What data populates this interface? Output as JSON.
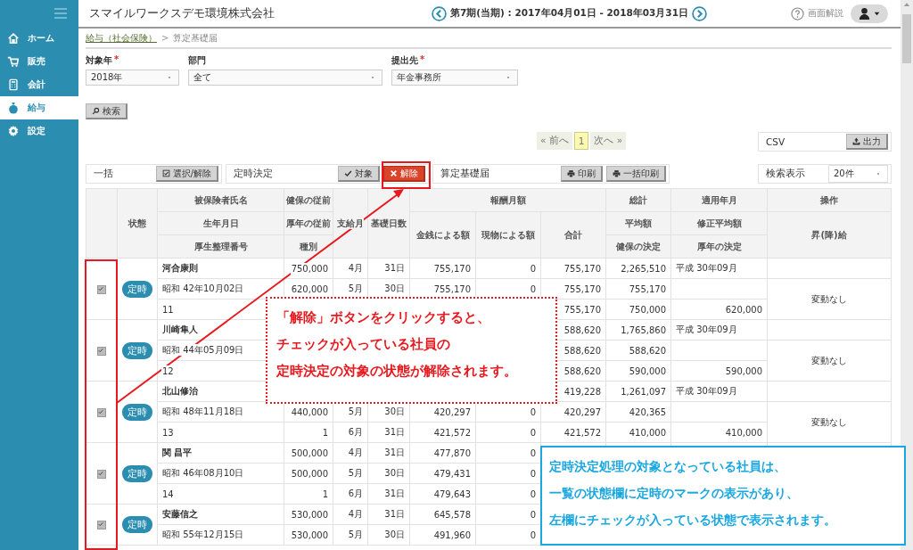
{
  "sidebar": {
    "items": [
      {
        "label": "ホーム",
        "selected": false
      },
      {
        "label": "販売",
        "selected": false
      },
      {
        "label": "会計",
        "selected": false
      },
      {
        "label": "給与",
        "selected": true
      },
      {
        "label": "設定",
        "selected": false
      }
    ]
  },
  "header": {
    "company": "スマイルワークスデモ環境株式会社",
    "period": "第7期(当期) : 2017年04月01日 - 2018年03月31日",
    "help": "画面解説"
  },
  "breadcrumb": {
    "items": [
      {
        "label": "給与（社会保険）",
        "link": true
      },
      {
        "label": "算定基礎届",
        "link": false
      }
    ],
    "separator": ">"
  },
  "filters": [
    {
      "label": "対象年",
      "required_mark": "*",
      "value": "2018年"
    },
    {
      "label": "部門",
      "value": "全て"
    },
    {
      "label": "提出先",
      "required_mark": "*",
      "value": "年金事務所"
    }
  ],
  "search_button": "検索",
  "pagination": {
    "prev": "« 前へ",
    "pages": [
      {
        "label": "1",
        "selected": true
      }
    ],
    "next": "次へ »"
  },
  "csv": {
    "label": "CSV",
    "button": "出力"
  },
  "toolbar": [
    {
      "label": "一括",
      "buttons": [
        {
          "label": "選択/解除",
          "kind": "toggle"
        }
      ]
    },
    {
      "label": "定時決定",
      "buttons": [
        {
          "label": "対象",
          "kind": "target"
        },
        {
          "label": "解除",
          "kind": "release"
        }
      ]
    },
    {
      "label": "算定基礎届",
      "buttons": [
        {
          "label": "印刷",
          "kind": "print"
        },
        {
          "label": "一括印刷",
          "kind": "print"
        }
      ]
    }
  ],
  "page_size": {
    "label": "検索表示",
    "value": "20件"
  },
  "table": {
    "headers": [
      "状態",
      "被保険者氏名",
      "健保の従前",
      "支給月",
      "基礎日数",
      "報酬月額",
      "総計",
      "適用年月",
      "操作",
      "生年月日",
      "厚年の従前",
      "金銭による額",
      "現物による額",
      "合計",
      "平均額",
      "修正平均額",
      "昇(降)給",
      "厚生整理番号",
      "種別",
      "健保の決定",
      "厚年の決定"
    ],
    "employees": [
      {
        "checked": true,
        "status": "定時",
        "change": "変動なし",
        "rows": [
          {
            "insured": "河合康則",
            "prior": "750,000",
            "pay_month": "4月",
            "base_days": "31日",
            "cash": "755,170",
            "in_kind": "0",
            "total": "755,170",
            "overall": "2,265,510",
            "applied": "平成 30年09月"
          },
          {
            "insured": "昭和 42年10月02日",
            "prior": "620,000",
            "pay_month": "5月",
            "base_days": "30日",
            "cash": "755,170",
            "in_kind": "0",
            "total": "755,170",
            "overall": "755,170"
          },
          {
            "insured": "11",
            "total": "755,170",
            "overall": "750,000",
            "applied": "620,000"
          }
        ]
      },
      {
        "checked": true,
        "status": "定時",
        "change": "変動なし",
        "rows": [
          {
            "insured": "川崎隼人",
            "total": "588,620",
            "overall": "1,765,860",
            "applied": "平成 30年09月"
          },
          {
            "insured": "昭和 44年05月09日",
            "total": "588,620",
            "overall": "588,620"
          },
          {
            "insured": "12",
            "total": "588,620",
            "overall": "590,000",
            "applied": "590,000"
          }
        ]
      },
      {
        "checked": true,
        "status": "定時",
        "change": "変動なし",
        "rows": [
          {
            "insured": "北山修治",
            "total": "419,228",
            "overall": "1,261,097",
            "applied": "平成 30年09月"
          },
          {
            "insured": "昭和 48年11月18日",
            "prior": "440,000",
            "pay_month": "5月",
            "base_days": "30日",
            "cash": "420,297",
            "in_kind": "0",
            "total": "420,297",
            "overall": "420,365"
          },
          {
            "insured": "13",
            "prior": "1",
            "pay_month": "6月",
            "base_days": "31日",
            "cash": "421,572",
            "in_kind": "0",
            "total": "421,572",
            "overall": "410,000",
            "applied": "410,000"
          }
        ]
      },
      {
        "checked": true,
        "status": "定時",
        "rows": [
          {
            "insured": "関 昌平",
            "prior": "500,000",
            "pay_month": "4月",
            "base_days": "31日",
            "cash": "477,870",
            "in_kind": "0"
          },
          {
            "insured": "昭和 46年08月10日",
            "prior": "500,000",
            "pay_month": "5月",
            "base_days": "30日",
            "cash": "479,431",
            "in_kind": "0"
          },
          {
            "insured": "14",
            "prior": "1",
            "pay_month": "6月",
            "base_days": "31日",
            "cash": "479,643",
            "in_kind": "0"
          }
        ]
      },
      {
        "checked": true,
        "status": "定時",
        "rows": [
          {
            "insured": "安藤信之",
            "prior": "530,000",
            "pay_month": "4月",
            "base_days": "31日",
            "cash": "645,578",
            "in_kind": "0"
          },
          {
            "insured": "昭和 55年12月15日",
            "prior": "530,000",
            "pay_month": "5月",
            "base_days": "30日",
            "cash": "491,960",
            "in_kind": "0"
          }
        ]
      }
    ]
  },
  "annotations": [
    {
      "kind": "dotted",
      "color": "#e8191e",
      "lines": [
        "「解除」ボタンをクリックすると、",
        "チェックが入っている社員の",
        "定時決定の対象の状態が解除されます。"
      ]
    },
    {
      "kind": "solid",
      "color": "#1ba8e0",
      "lines": [
        "定時決定処理の対象となっている社員は、",
        "一覧の状態欄に定時のマークの表示があり、",
        "左欄にチェックが入っている状態で表示されます。"
      ]
    }
  ]
}
